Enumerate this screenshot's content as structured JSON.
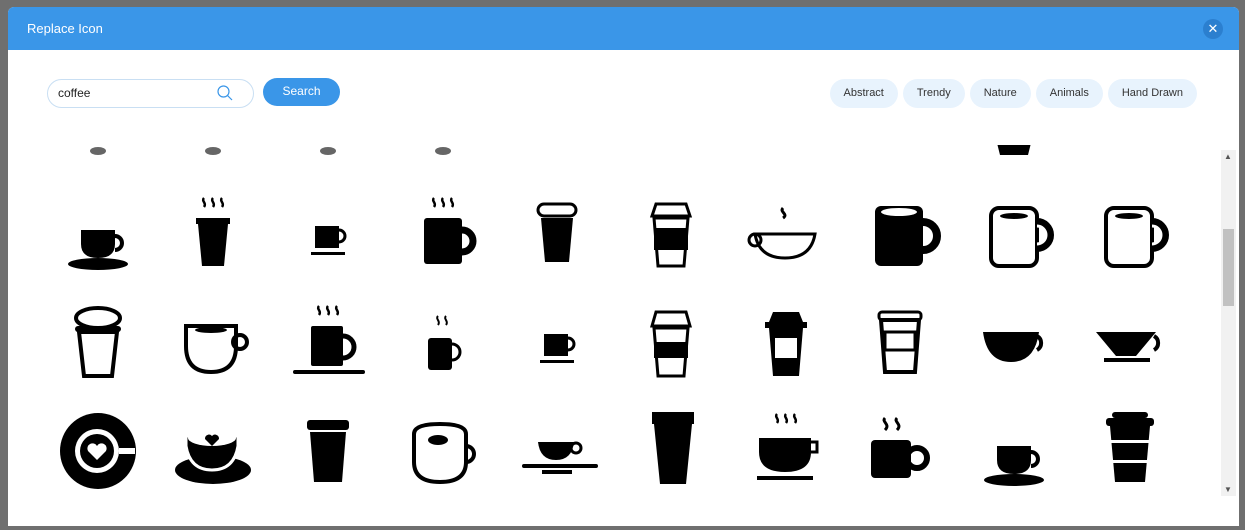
{
  "dialog": {
    "title": "Replace Icon",
    "close_icon": "close-icon"
  },
  "search": {
    "value": "coffee",
    "button": "Search"
  },
  "categories": [
    "Abstract",
    "Trendy",
    "Nature",
    "Animals",
    "Hand Drawn"
  ],
  "colors": {
    "accent": "#3a96e8",
    "chip": "#e8f3fd"
  },
  "icons": [
    [
      "cup-saucer",
      "takeaway-steam",
      "small-cup-saucer",
      "mug-steam",
      "takeaway-lid",
      "takeaway-sleeve",
      "cup-steam-outline",
      "mug-solid",
      "mug-outline",
      "mug-outline"
    ],
    [
      "takeaway-outline",
      "cup-outline",
      "mug-steam-plate",
      "mug-steam-small",
      "small-cup-saucer",
      "takeaway-sleeve-outline",
      "takeaway-solid",
      "glass-outline",
      "bowl-cup",
      "pour-over"
    ],
    [
      "cup-topview-heart",
      "latte-art",
      "takeaway-plain",
      "mug-rounded",
      "cup-saucer-flat",
      "takeaway-tall",
      "cup-steam-saucer",
      "mug-steam-solid",
      "cup-saucer",
      "takeaway-striped"
    ]
  ]
}
